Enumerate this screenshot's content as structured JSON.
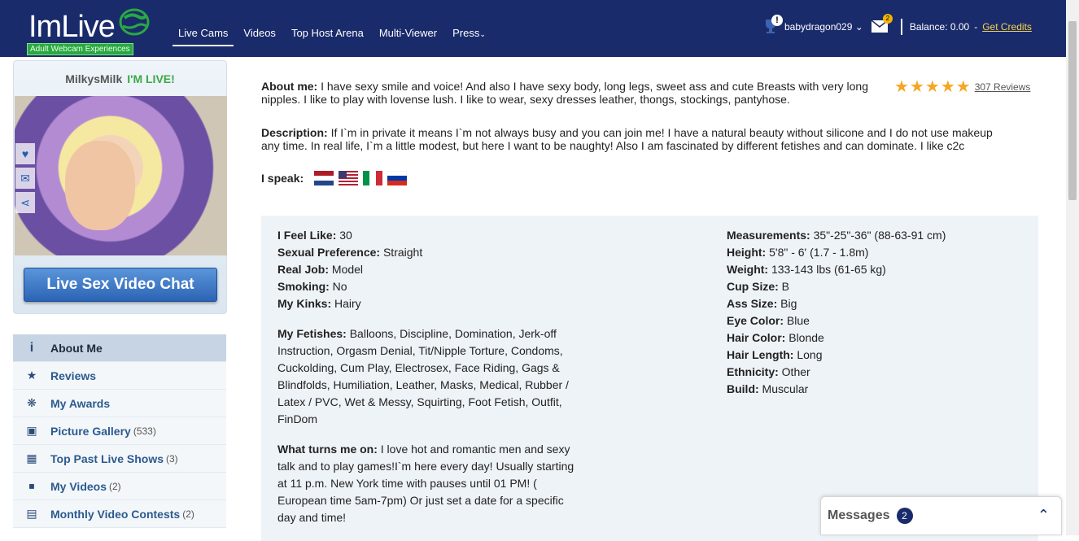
{
  "header": {
    "logo_text": "ImLive",
    "logo_tagline": "Adult Webcam Experiences",
    "nav": [
      "Live Cams",
      "Videos",
      "Top Host Arena",
      "Multi-Viewer",
      "Press"
    ],
    "username": "babydragon029",
    "mail_count": "2",
    "alert": "!",
    "balance": "Balance: 0.00",
    "balance_sep": "-",
    "get_credits": "Get Credits"
  },
  "profile": {
    "name": "MilkysMilk",
    "live_status": "I'M LIVE!",
    "chat_button": "Live Sex Video Chat"
  },
  "menu": [
    {
      "label": "About Me",
      "count": ""
    },
    {
      "label": "Reviews",
      "count": ""
    },
    {
      "label": "My Awards",
      "count": ""
    },
    {
      "label": "Picture Gallery",
      "count": "(533)"
    },
    {
      "label": "Top Past Live Shows",
      "count": "(3)"
    },
    {
      "label": "My Videos",
      "count": "(2)"
    },
    {
      "label": "Monthly Video Contests",
      "count": "(2)"
    }
  ],
  "about": {
    "about_label": "About me:",
    "about_text": "I have sexy smile and voice! And also I have sexy body, long legs, sweet ass and cute Breasts with very long nipples. I like to play with lovense lush. I like to wear, sexy dresses leather, thongs, stockings, pantyhose.",
    "rating_stars": 5,
    "reviews": "307 Reviews",
    "desc_label": "Description:",
    "desc_text": "If I`m in private it means I`m not always busy and you can join me! I have a natural beauty without silicone and I do not use makeup any time. In real life, I`m a little modest, but here I want to be naughty! Also I am fascinated by different fetishes and can dominate. I like c2c",
    "speak_label": "I speak:"
  },
  "details_left": {
    "feel_like_label": "I Feel Like:",
    "feel_like": "30",
    "pref_label": "Sexual Preference:",
    "pref": "Straight",
    "job_label": "Real Job:",
    "job": "Model",
    "smoking_label": "Smoking:",
    "smoking": "No",
    "kinks_label": "My Kinks:",
    "kinks": "Hairy",
    "fetishes_label": "My Fetishes:",
    "fetishes": "Balloons, Discipline, Domination, Jerk-off Instruction, Orgasm Denial, Tit/Nipple Torture, Condoms, Cuckolding, Cum Play, Electrosex, Face Riding, Gags & Blindfolds, Humiliation, Leather, Masks, Medical, Rubber / Latex / PVC, Wet & Messy, Squirting, Foot Fetish, Outfit, FinDom",
    "turns_label": "What turns me on:",
    "turns": "I love hot and romantic men and sexy talk and to play games!I`m here every day! Usually starting at 11 p.m. New York time with pauses until 01 PM! ( European time 5am-7pm) Or just set a date for a specific day and time!"
  },
  "details_right": {
    "measure_label": "Measurements:",
    "measure": "35\"-25\"-36\" (88-63-91 cm)",
    "height_label": "Height:",
    "height": "5'8\" - 6' (1.7 - 1.8m)",
    "weight_label": "Weight:",
    "weight": "133-143 lbs (61-65 kg)",
    "cup_label": "Cup Size:",
    "cup": "B",
    "ass_label": "Ass Size:",
    "ass": "Big",
    "eye_label": "Eye Color:",
    "eye": "Blue",
    "hair_label": "Hair Color:",
    "hair": "Blonde",
    "hairlen_label": "Hair Length:",
    "hairlen": "Long",
    "eth_label": "Ethnicity:",
    "eth": "Other",
    "build_label": "Build:",
    "build": "Muscular"
  },
  "messages": {
    "label": "Messages",
    "count": "2"
  }
}
